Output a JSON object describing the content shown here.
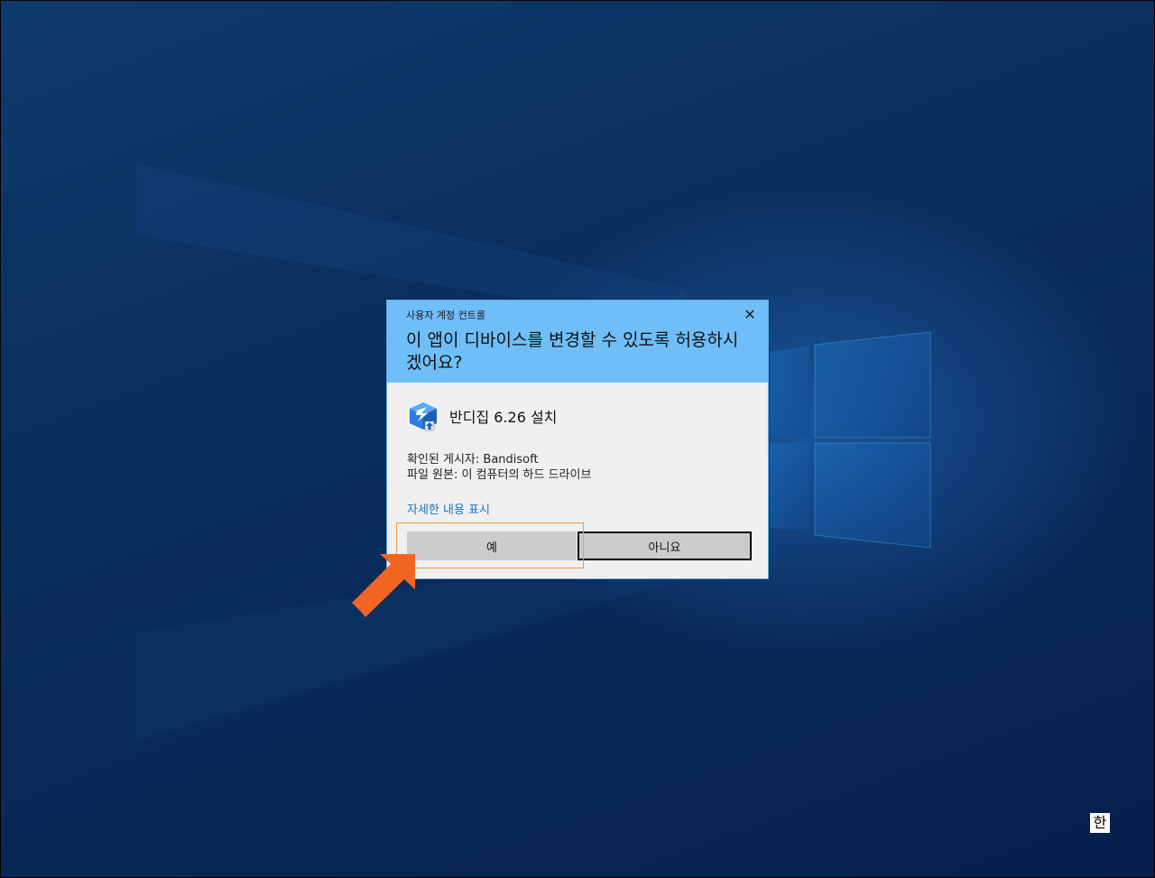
{
  "uac": {
    "caption": "사용자 계정 컨트롤",
    "close_glyph": "✕",
    "question": "이 앱이 디바이스를 변경할 수 있도록 허용하시겠어요?",
    "app_name": "반디집 6.26 설치",
    "app_icon": "bandizip-installer-icon",
    "publisher_line": "확인된 게시자: Bandisoft",
    "origin_line": "파일 원본: 이 컴퓨터의 하드 드라이브",
    "details_link": "자세한 내용 표시",
    "yes_label": "예",
    "no_label": "아니요"
  },
  "taskbar": {
    "ime_indicator": "한"
  },
  "colors": {
    "header": "#6fbef8",
    "body": "#f0f0f0",
    "link": "#1a73c8",
    "button": "#cccccc",
    "annotation": "#f26522"
  }
}
